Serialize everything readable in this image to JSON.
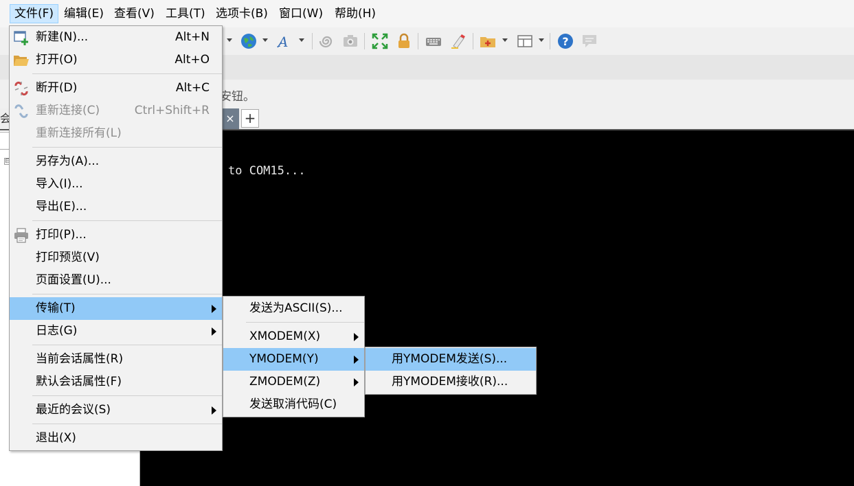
{
  "menubar": {
    "items": [
      "文件(F)",
      "编辑(E)",
      "查看(V)",
      "工具(T)",
      "选项卡(B)",
      "窗口(W)",
      "帮助(H)"
    ]
  },
  "toolbar": {
    "icons": [
      "globe-icon",
      "font-icon",
      "spiral-icon",
      "camera-icon",
      "fullscreen-icon",
      "lock-icon",
      "keyboard-icon",
      "highlight-icon",
      "new-folder-icon",
      "layout-icon",
      "help-icon",
      "chat-icon"
    ]
  },
  "hint_text": "安钮。",
  "terminal": {
    "line1": "to COM15..."
  },
  "tab": {
    "close": "×",
    "add": "+"
  },
  "left_pane": {
    "header_char": "会",
    "tree_toggle": "⊟"
  },
  "file_menu": {
    "new_label": "新建(N)...",
    "new_shortcut": "Alt+N",
    "open_label": "打开(O)",
    "open_shortcut": "Alt+O",
    "disconnect_label": "断开(D)",
    "disconnect_shortcut": "Alt+C",
    "reconnect_label": "重新连接(C)",
    "reconnect_shortcut": "Ctrl+Shift+R",
    "reconnect_all_label": "重新连接所有(L)",
    "save_as_label": "另存为(A)...",
    "import_label": "导入(I)...",
    "export_label": "导出(E)...",
    "print_label": "打印(P)...",
    "print_preview_label": "打印预览(V)",
    "page_setup_label": "页面设置(U)...",
    "transfer_label": "传输(T)",
    "log_label": "日志(G)",
    "current_props_label": "当前会话属性(R)",
    "default_props_label": "默认会话属性(F)",
    "recent_label": "最近的会议(S)",
    "exit_label": "退出(X)"
  },
  "transfer_menu": {
    "send_ascii": "发送为ASCII(S)...",
    "xmodem": "XMODEM(X)",
    "ymodem": "YMODEM(Y)",
    "zmodem": "ZMODEM(Z)",
    "send_cancel": "发送取消代码(C)"
  },
  "ymodem_menu": {
    "send": "用YMODEM发送(S)...",
    "receive": "用YMODEM接收(R)..."
  },
  "colors": {
    "menu_highlight": "#91c9f7",
    "menubar_active": "#cce8ff",
    "terminal_bg": "#000000"
  }
}
